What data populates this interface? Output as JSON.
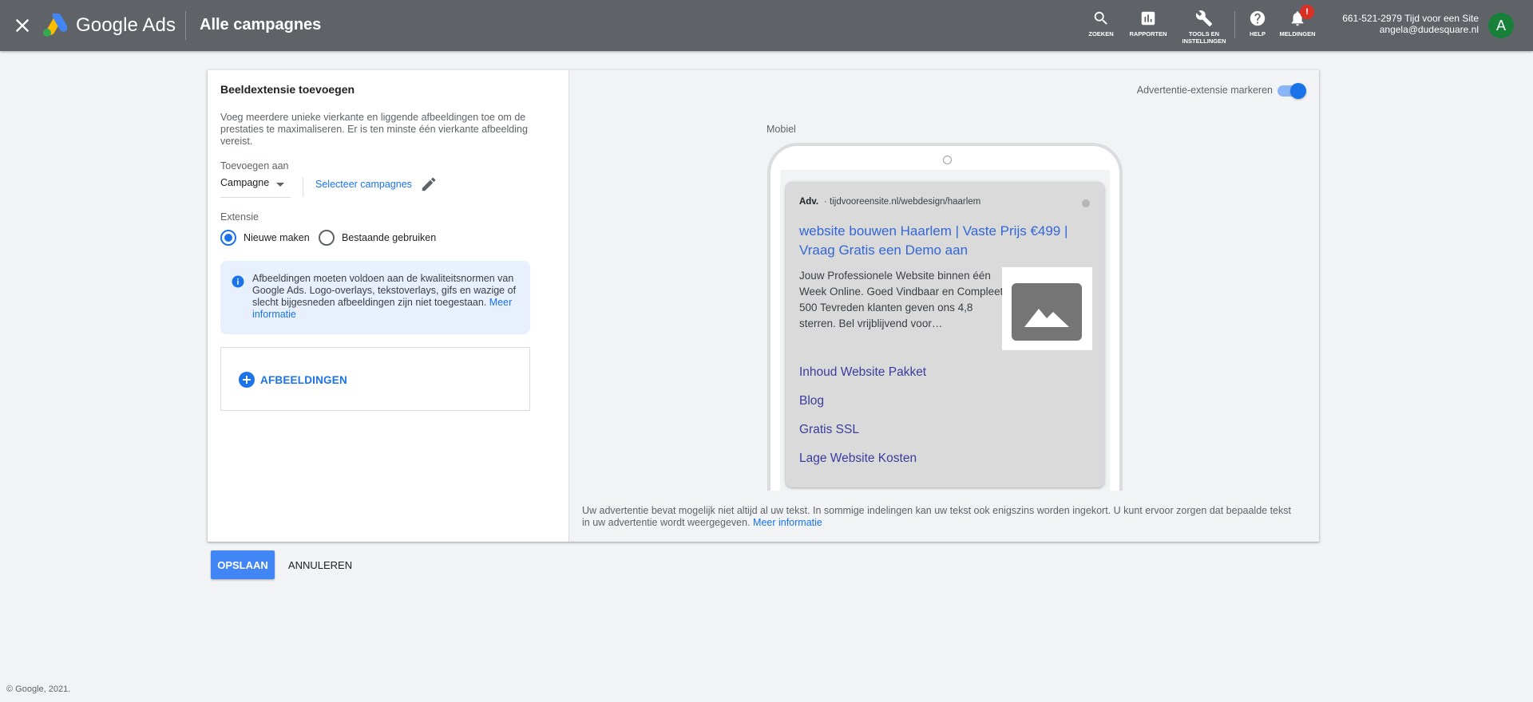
{
  "header": {
    "brand": "Google Ads",
    "page_title": "Alle campagnes",
    "tools": {
      "search": "ZOEKEN",
      "reports": "RAPPORTEN",
      "tools_line1": "TOOLS EN",
      "tools_line2": "INSTELLINGEN",
      "help": "HELP",
      "notifications": "MELDINGEN",
      "notifications_badge": "!"
    },
    "account": {
      "line1": "661-521-2979 Tijd voor een Site",
      "email": "angela@dudesquare.nl",
      "avatar_letter": "A"
    }
  },
  "form": {
    "title": "Beeldextensie toevoegen",
    "description": "Voeg meerdere unieke vierkante en liggende afbeeldingen toe om de prestaties te maximaliseren. Er is ten minste één vierkante afbeelding vereist.",
    "add_to_label": "Toevoegen aan",
    "add_to_value": "Campagne",
    "select_campaigns": "Selecteer campagnes",
    "extension_label": "Extensie",
    "radio_new": "Nieuwe maken",
    "radio_existing": "Bestaande gebruiken",
    "radio_selected": "new",
    "info_text": "Afbeeldingen moeten voldoen aan de kwaliteitsnormen van Google Ads. Logo-overlays, tekstoverlays, gifs en wazige of slecht bijgesneden afbeeldingen zijn niet toegestaan.",
    "info_link": "Meer informatie",
    "upload_label": "AFBEELDINGEN"
  },
  "preview": {
    "highlight_label": "Advertentie-extensie markeren",
    "highlight_on": true,
    "device_label": "Mobiel",
    "ad": {
      "badge": "Adv.",
      "url": "· tijdvooreensite.nl/webdesign/haarlem",
      "headline": "website bouwen Haarlem | Vaste Prijs €499 | Vraag Gratis een Demo aan",
      "description": "Jouw Professionele Website binnen één Week Online. Goed Vindbaar en Compleet. 500 Tevreden klanten geven ons 4,8 sterren. Bel vrijblijvend voor…",
      "sitelinks": [
        "Inhoud Website Pakket",
        "Blog",
        "Gratis SSL",
        "Lage Website Kosten"
      ]
    },
    "footer_note": "Uw advertentie bevat mogelijk niet altijd al uw tekst. In sommige indelingen kan uw tekst ook enigszins worden ingekort. U kunt ervoor zorgen dat bepaalde tekst in uw advertentie wordt weergegeven.",
    "footer_link": "Meer informatie"
  },
  "actions": {
    "save": "OPSLAAN",
    "cancel": "ANNULEREN"
  },
  "copyright": "© Google, 2021.",
  "colors": {
    "topbar": "#5f6368",
    "accent": "#1a73e8",
    "save_button": "#4285f4",
    "avatar": "#188038",
    "notification_badge": "#d93025"
  }
}
